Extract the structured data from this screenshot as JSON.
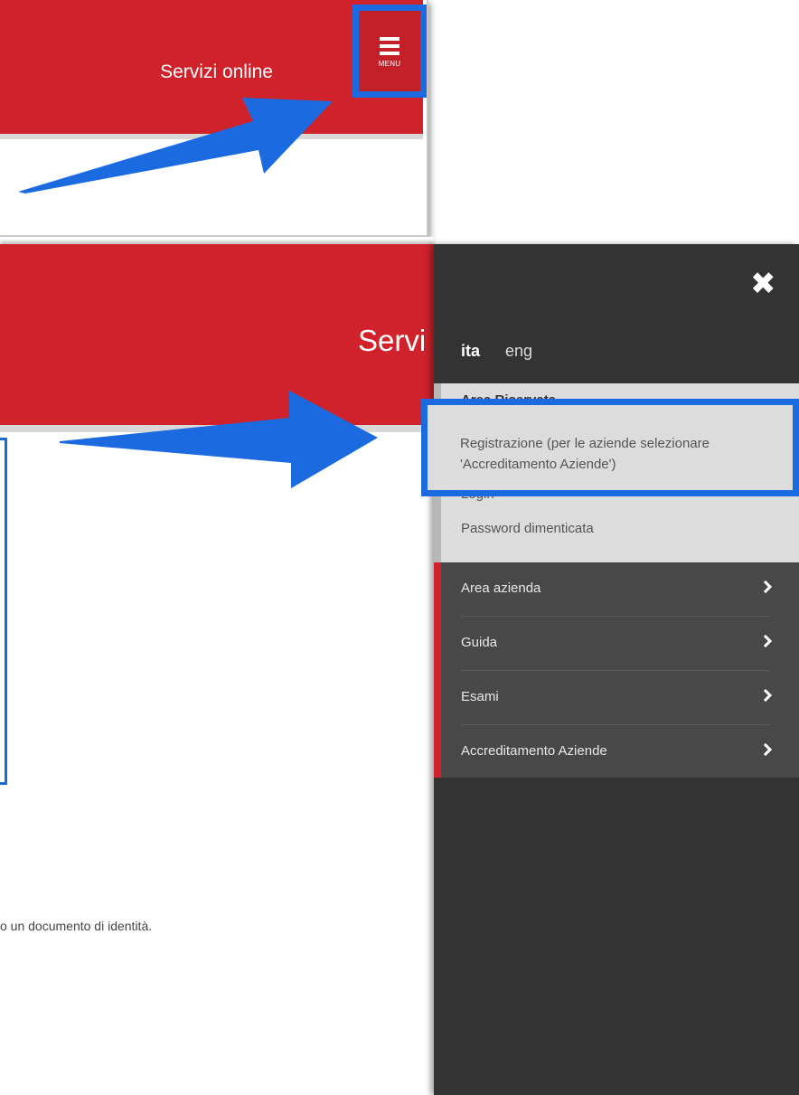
{
  "top": {
    "title": "Servizi online",
    "menu_label": "MENU"
  },
  "page": {
    "title": "Servi",
    "body_text": "o un documento di identità."
  },
  "side_menu": {
    "close_icon": "close-icon",
    "languages": [
      "ita",
      "eng"
    ],
    "reserved_area": {
      "title": "Area Riservata",
      "registration": "Registrazione (per le aziende selezionare 'Accreditamento Aziende')",
      "login": "Login",
      "forgot_password": "Password dimenticata"
    },
    "items": [
      {
        "label": "Area azienda"
      },
      {
        "label": "Guida"
      },
      {
        "label": "Esami"
      },
      {
        "label": "Accreditamento Aziende"
      }
    ]
  },
  "colors": {
    "brand_red": "#d0222b",
    "highlight_blue": "#1b6ae0",
    "menu_dark": "#333333"
  }
}
